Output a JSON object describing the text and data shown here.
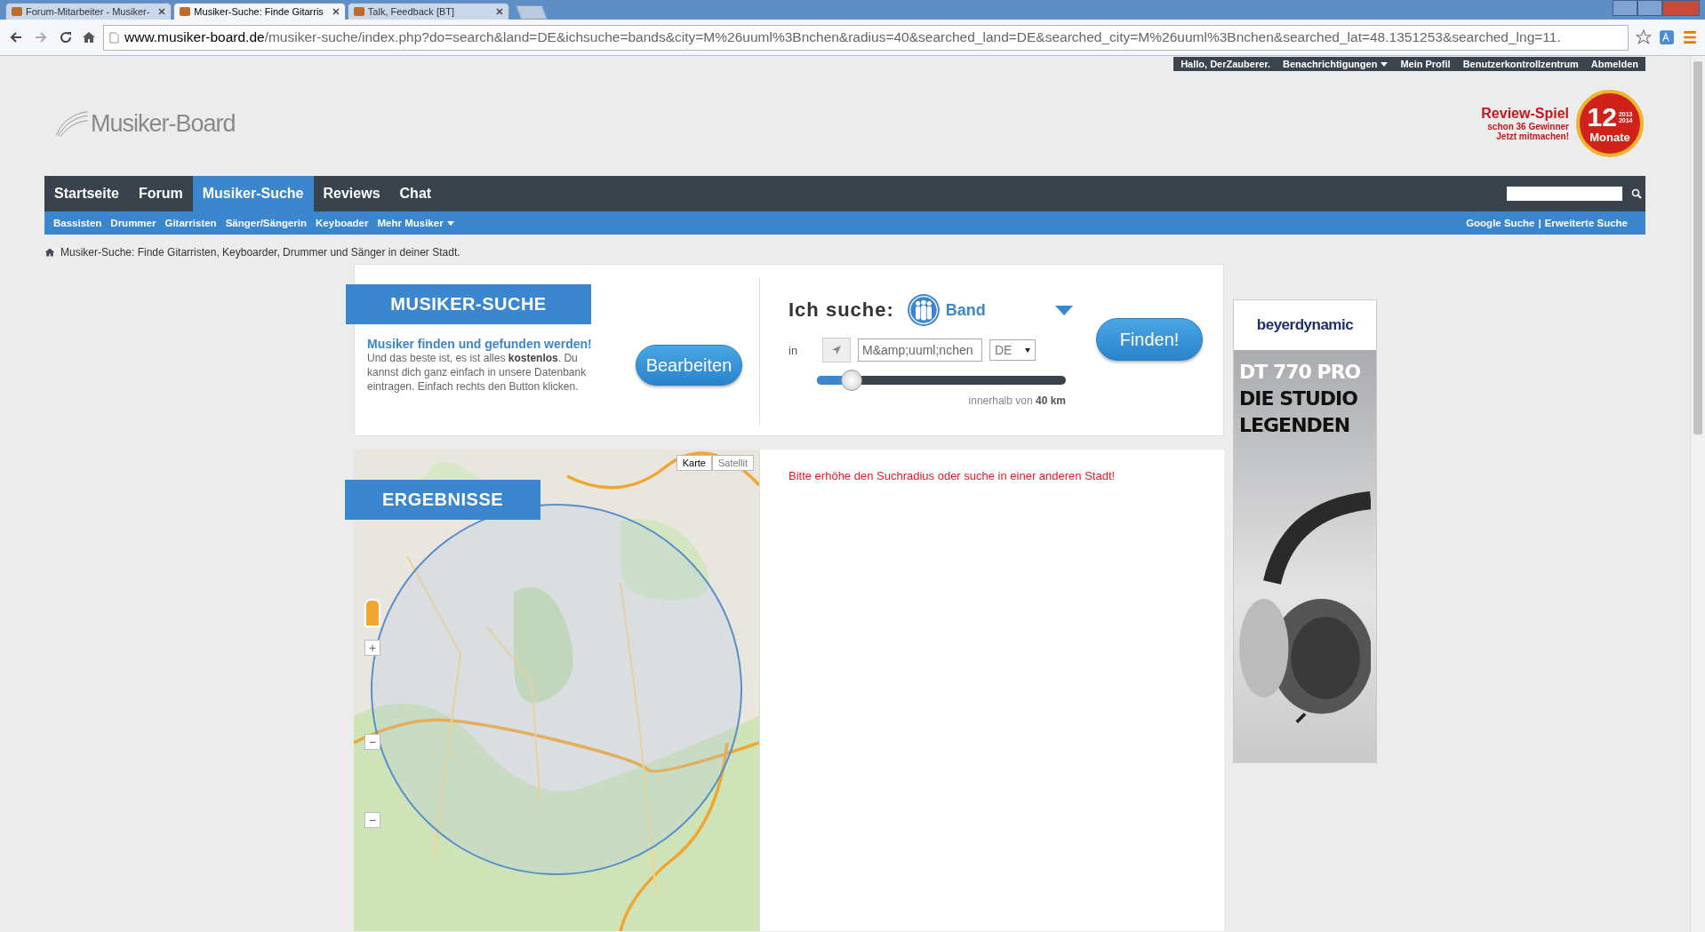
{
  "browser": {
    "tabs": [
      {
        "title": "Forum-Mitarbeiter - Musiker-",
        "selected": false
      },
      {
        "title": "Musiker-Suche: Finde Gitarris",
        "selected": true
      },
      {
        "title": "Talk, Feedback [BT]",
        "selected": false
      }
    ],
    "url": {
      "host": "www.musiker-board.de",
      "path": "/musiker-suche/index.php?do=search&land=DE&ichsuche=bands&city=M%26uuml%3Bnchen&radius=40&searched_land=DE&searched_city=M%26uuml%3Bnchen&searched_lat=48.1351253&searched_lng=11."
    }
  },
  "user_bar": {
    "greeting": "Hallo, DerZauberer.",
    "items": [
      {
        "label": "Benachrichtigungen",
        "dropdown": true
      },
      {
        "label": "Mein Profil",
        "dropdown": false
      },
      {
        "label": "Benutzerkontrollzentrum",
        "dropdown": false
      },
      {
        "label": "Abmelden",
        "dropdown": false
      }
    ]
  },
  "logo": {
    "text": "Musiker-Board"
  },
  "promo": {
    "title": "Review-Spiel",
    "lines": [
      "schon 36 Gewinner",
      "Jetzt mitmachen!"
    ],
    "badge": {
      "number": "12",
      "years": [
        "2013",
        "2014"
      ],
      "label": "Monate"
    }
  },
  "nav": {
    "tabs": [
      {
        "label": "Startseite",
        "selected": false
      },
      {
        "label": "Forum",
        "selected": false
      },
      {
        "label": "Musiker-Suche",
        "selected": true
      },
      {
        "label": "Reviews",
        "selected": false
      },
      {
        "label": "Chat",
        "selected": false
      }
    ]
  },
  "subnav": {
    "items": [
      {
        "label": "Bassisten",
        "dropdown": false
      },
      {
        "label": "Drummer",
        "dropdown": false
      },
      {
        "label": "Gitarristen",
        "dropdown": false
      },
      {
        "label": "Sänger/Sängerin",
        "dropdown": false
      },
      {
        "label": "Keyboader",
        "dropdown": false
      },
      {
        "label": "Mehr Musiker",
        "dropdown": true
      }
    ],
    "right_links": [
      "Google Suche",
      "Erweiterte Suche"
    ],
    "separator": "|"
  },
  "breadcrumb": "Musiker-Suche: Finde Gitarristen, Keyboarder, Drummer und Sänger in deiner Stadt.",
  "search_panel": {
    "heading": "MUSIKER-SUCHE",
    "intro_title": "Musiker finden und gefunden werden!",
    "intro_text": "Und das beste ist, es ist alles **kostenlos**. Du kannst dich ganz einfach in unsere Datenbank eintragen. Einfach rechts den Button klicken.",
    "edit_button": "Bearbeiten",
    "search_label": "Ich suche:",
    "search_type": "Band",
    "in_label": "in",
    "city": "M&amp;uuml;nchen",
    "country": "DE",
    "radius": {
      "level": 0.14,
      "reading": "innerhalb von **40 km**"
    },
    "find_button": "Finden!"
  },
  "results": {
    "heading": "ERGEBNISSE",
    "map_types": [
      {
        "label": "Karte",
        "selected": true
      },
      {
        "label": "Satellit",
        "selected": false
      }
    ],
    "zoom_controls": [
      "+",
      "−",
      "−"
    ],
    "message": "Bitte erhöhe den Suchradius oder suche in einer anderen Stadt!"
  },
  "ad": {
    "brand": "beyerdynamic",
    "headline": [
      "DT 770 PRO",
      "DIE STUDIO",
      "LEGENDEN"
    ]
  }
}
